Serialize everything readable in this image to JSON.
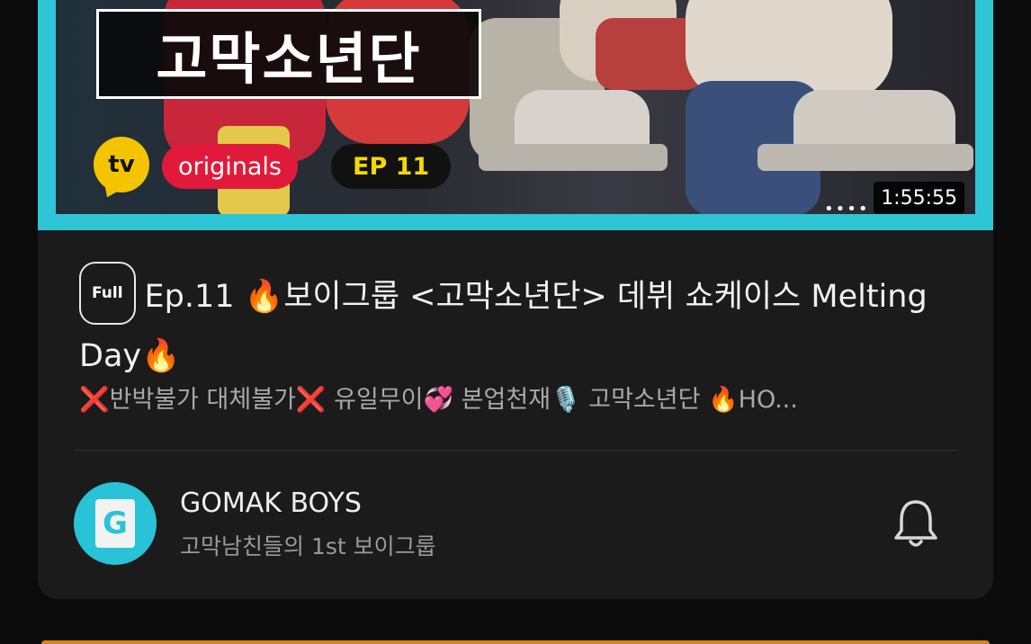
{
  "thumbnail": {
    "show_title": "고막소년단",
    "tv_logo": "tv",
    "originals_label": "originals",
    "episode_label": "EP 11",
    "more_dots": "••••",
    "duration": "1:55:55"
  },
  "video": {
    "full_badge": "Full",
    "title": "Ep.11 🔥보이그룹 <고막소년단> 데뷔 쇼케이스 Melting Day🔥",
    "description": "❌반박불가 대체불가❌ 유일무이💞 본업천재🎙️ 고막소년단 🔥HO..."
  },
  "channel": {
    "avatar_letter": "G",
    "name": "GOMAK BOYS",
    "subtitle": "고막남친들의 1st 보이그룹",
    "bell_icon": "bell-icon"
  },
  "colors": {
    "accent_cyan": "#2ec6d6",
    "originals_red": "#e11a3b",
    "ep_yellow": "#f5d800",
    "tv_yellow": "#f5c400"
  }
}
